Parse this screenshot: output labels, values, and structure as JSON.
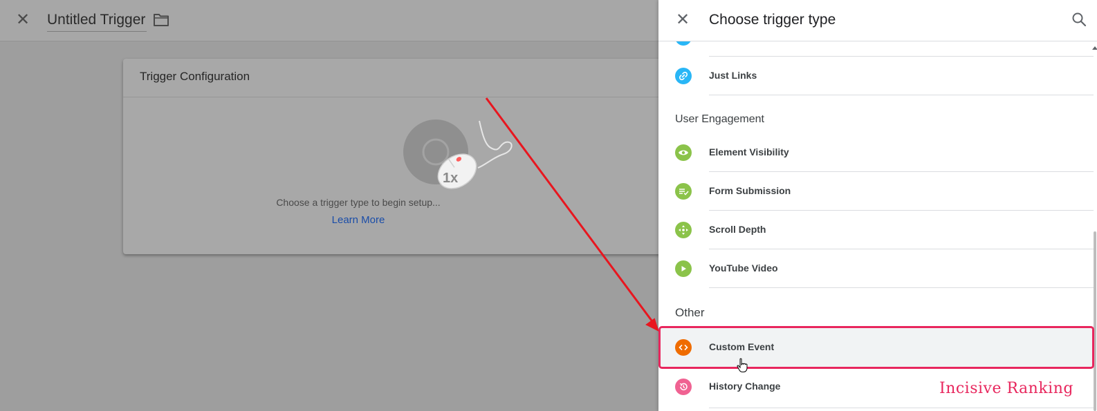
{
  "editor": {
    "close_icon": "close-icon",
    "title": "Untitled Trigger",
    "folder_icon": "folder-icon",
    "card": {
      "header": "Trigger Configuration",
      "prompt": "Choose a trigger type to begin setup...",
      "learn_more": "Learn More",
      "illustration_badge": "1x"
    }
  },
  "panel": {
    "title": "Choose trigger type",
    "close_icon": "close-icon",
    "search_icon": "search-icon",
    "items": [
      {
        "label": "Just Links",
        "icon": "link-icon",
        "color": "#29b6f6"
      },
      {
        "label": "Element Visibility",
        "icon": "eye-icon",
        "color": "#8bc34a"
      },
      {
        "label": "Form Submission",
        "icon": "form-check-icon",
        "color": "#8bc34a"
      },
      {
        "label": "Scroll Depth",
        "icon": "scroll-arrows-icon",
        "color": "#8bc34a"
      },
      {
        "label": "YouTube Video",
        "icon": "play-icon",
        "color": "#8bc34a"
      },
      {
        "label": "Custom Event",
        "icon": "code-brackets-icon",
        "color": "#ef6c00"
      },
      {
        "label": "History Change",
        "icon": "history-icon",
        "color": "#f06292"
      }
    ],
    "sections": {
      "user_engagement": "User Engagement",
      "other": "Other"
    },
    "selected_item": "Custom Event"
  },
  "annotation": {
    "watermark": "Incisive Ranking",
    "highlight_color": "#e8265d",
    "arrow_color": "#e8161f"
  }
}
